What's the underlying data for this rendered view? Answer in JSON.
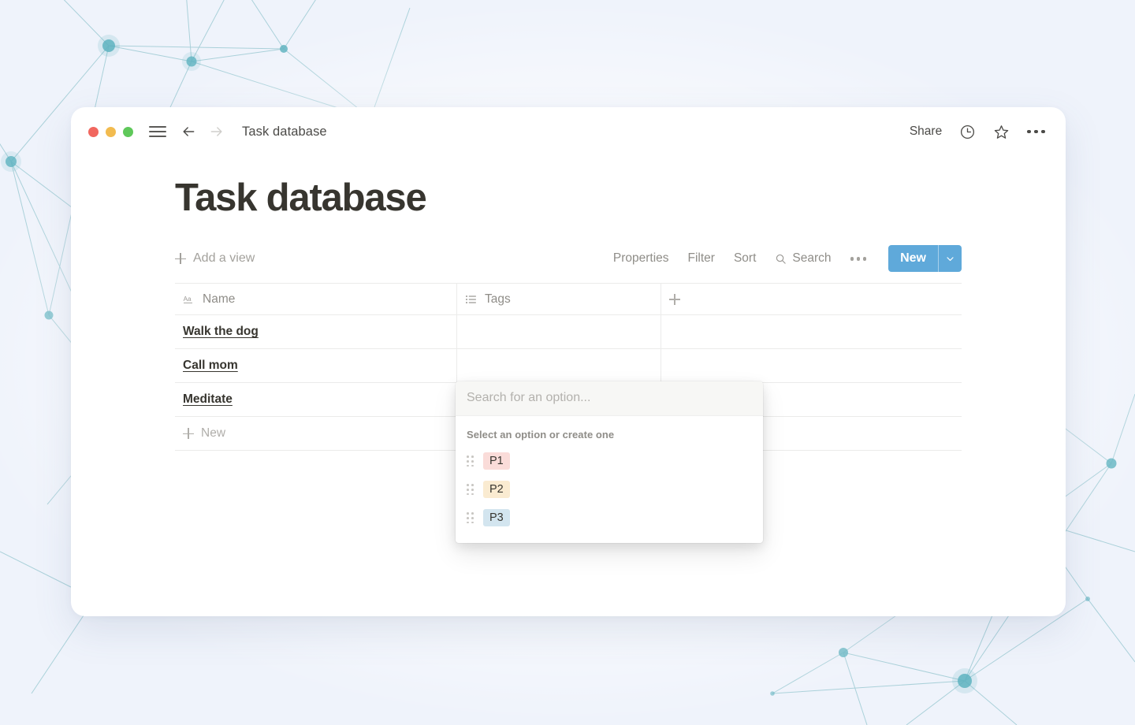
{
  "background": {
    "color": "#eff3fb",
    "pattern": "network-constellation",
    "node_color": "#5fb3c0",
    "line_color": "#9ecbd4"
  },
  "titlebar": {
    "traffic_lights": [
      "close-red",
      "minimize-yellow",
      "maximize-green"
    ],
    "menu_icon": "hamburger-icon",
    "back_icon": "arrow-left-icon",
    "forward_icon": "arrow-right-icon",
    "title": "Task database",
    "share_label": "Share",
    "history_icon": "clock-icon",
    "favorite_icon": "star-icon",
    "more_icon": "ellipsis-icon"
  },
  "page": {
    "title": "Task database"
  },
  "toolbar": {
    "add_view_label": "Add a view",
    "add_view_icon": "plus-icon",
    "properties_label": "Properties",
    "filter_label": "Filter",
    "sort_label": "Sort",
    "search_label": "Search",
    "search_icon": "magnifier-icon",
    "more_icon": "ellipsis-icon",
    "new_label": "New",
    "new_caret_icon": "chevron-down-icon",
    "new_button_color": "#5fa9da"
  },
  "table": {
    "columns": [
      {
        "label": "Name",
        "icon": "text-aa-icon"
      },
      {
        "label": "Tags",
        "icon": "multi-select-list-icon"
      }
    ],
    "add_column_icon": "plus-icon",
    "rows": [
      {
        "name": "Walk the dog",
        "tags": ""
      },
      {
        "name": "Call mom",
        "tags": ""
      },
      {
        "name": "Meditate",
        "tags": ""
      }
    ],
    "new_row_label": "New",
    "new_row_icon": "plus-icon"
  },
  "option_popup": {
    "search_placeholder": "Search for an option...",
    "search_value": "",
    "list_label": "Select an option or create one",
    "options": [
      {
        "label": "P1",
        "bg": "#fadcd9",
        "text": "#37352f",
        "handle_icon": "drag-handle-icon"
      },
      {
        "label": "P2",
        "bg": "#faebd1",
        "text": "#37352f",
        "handle_icon": "drag-handle-icon"
      },
      {
        "label": "P3",
        "bg": "#d3e5ef",
        "text": "#37352f",
        "handle_icon": "drag-handle-icon"
      }
    ]
  }
}
